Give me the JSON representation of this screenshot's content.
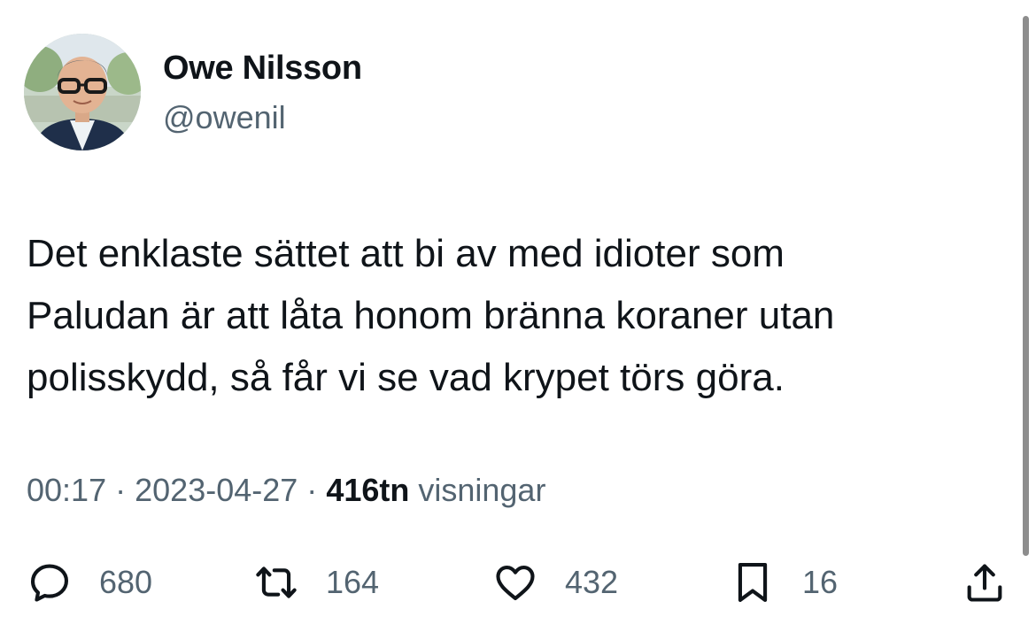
{
  "author": {
    "display_name": "Owe Nilsson",
    "handle": "@owenil"
  },
  "tweet": {
    "lines": [
      "Det enklaste sättet att bi av med idioter som",
      "Paludan är att låta honom bränna koraner utan",
      "polisskydd, så får vi se vad krypet törs göra."
    ]
  },
  "meta": {
    "time": "00:17",
    "separator": "·",
    "date": "2023-04-27",
    "views_count": "416tn",
    "views_label": "visningar"
  },
  "actions": {
    "replies": "680",
    "retweets": "164",
    "likes": "432",
    "bookmarks": "16"
  },
  "icons": [
    "reply-icon",
    "retweet-icon",
    "like-icon",
    "bookmark-icon",
    "share-icon"
  ],
  "colors": {
    "text_primary": "#0f1419",
    "text_secondary": "#536471",
    "background": "#ffffff"
  }
}
